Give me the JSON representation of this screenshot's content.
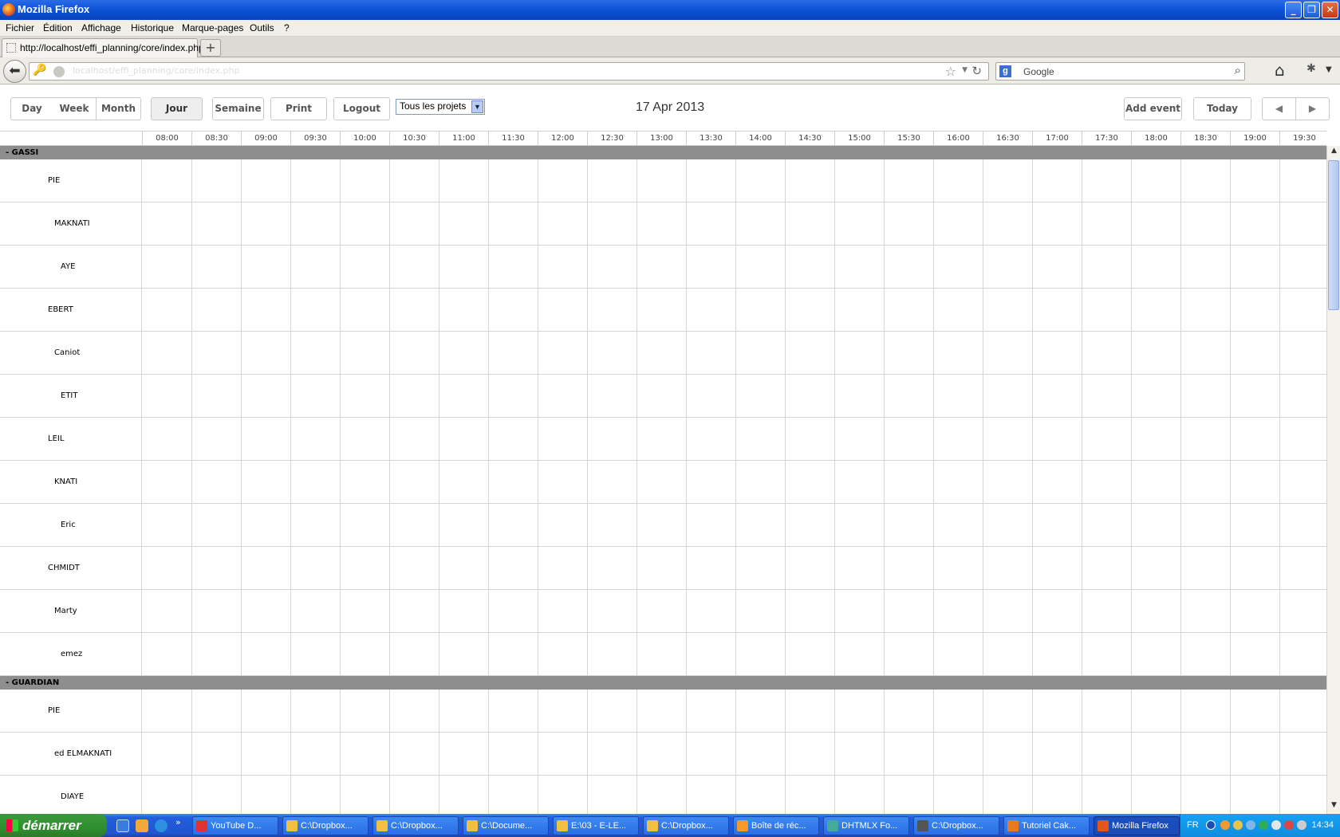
{
  "window": {
    "title": "Mozilla Firefox"
  },
  "menu": [
    "Fichier",
    "Édition",
    "Affichage",
    "Historique",
    "Marque-pages",
    "Outils",
    "?"
  ],
  "tab": {
    "label": "http://localhost/effi_planning/core/index.php",
    "new_tab": "+"
  },
  "nav": {
    "url": "localhost/effi_planning/core/index.php",
    "search_placeholder": "Google"
  },
  "toolbar": {
    "views": [
      "Day",
      "Week",
      "Month"
    ],
    "jour": "Jour",
    "semaine": "Semaine",
    "print": "Print",
    "logout": "Logout",
    "project_select": "Tous les projets",
    "date": "17 Apr 2013",
    "add_event": "Add event",
    "today": "Today",
    "prev": "◀",
    "next": "▶"
  },
  "times": [
    "08:00",
    "08:30",
    "09:00",
    "09:30",
    "10:00",
    "10:30",
    "11:00",
    "11:30",
    "12:00",
    "12:30",
    "13:00",
    "13:30",
    "14:00",
    "14:30",
    "15:00",
    "15:30",
    "16:00",
    "16:30",
    "17:00",
    "17:30",
    "18:00",
    "18:30",
    "19:00",
    "19:30"
  ],
  "sections": [
    {
      "label": "- GASSI",
      "rows": [
        "PIE",
        "MAKNATI",
        "AYE",
        "EBERT",
        "Caniot",
        "ETIT",
        "LEIL",
        "KNATI",
        "Eric",
        "CHMIDT",
        "Marty",
        "emez"
      ]
    },
    {
      "label": "- GUARDIAN",
      "rows": [
        "PIE",
        "ed ELMAKNATI",
        "DIAYE"
      ]
    }
  ],
  "taskbar": {
    "start": "démarrer",
    "tasks": [
      "YouTube D...",
      "C:\\Dropbox...",
      "C:\\Dropbox...",
      "C:\\Docume...",
      "E:\\03 - E-LE...",
      "C:\\Dropbox...",
      "Boîte de réc...",
      "DHTMLX Fo...",
      "C:\\Dropbox...",
      "Tutoriel Cak...",
      "Mozilla Firefox"
    ],
    "lang": "FR",
    "clock": "14:34"
  },
  "colors": {
    "section_header": "#8e8e8e",
    "titlebar": "#0a52d6",
    "taskbar": "#245edb",
    "start": "#2f8f2f"
  }
}
